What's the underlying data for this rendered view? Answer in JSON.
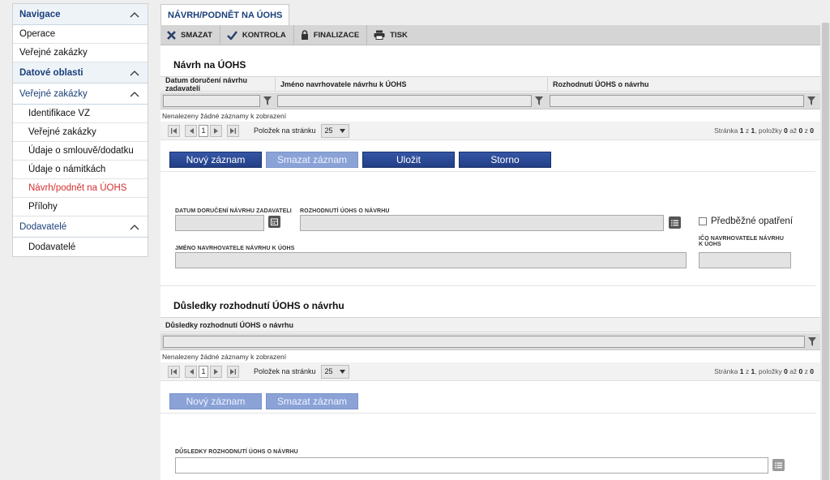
{
  "sidebar": {
    "nav_title": "Navigace",
    "nav_items": [
      "Operace",
      "Veřejné zakázky"
    ],
    "data_title": "Datové oblasti",
    "vz_title": "Veřejné zakázky",
    "vz_items": [
      "Identifikace VZ",
      "Veřejné zakázky",
      "Údaje o smlouvě/dodatku",
      "Údaje o námitkách",
      "Návrh/podnět na ÚOHS",
      "Přílohy"
    ],
    "dod_title": "Dodavatelé",
    "dod_items": [
      "Dodavatelé"
    ]
  },
  "tab": {
    "label": "NÁVRH/PODNĚT NA ÚOHS"
  },
  "toolbar": {
    "delete": "SMAZAT",
    "check": "KONTROLA",
    "finalize": "FINALIZACE",
    "print": "TISK"
  },
  "section1": {
    "title": "Návrh na ÚOHS",
    "columns": [
      "Datum doručení návrhu zadavateli",
      "Jméno navrhovatele návrhu k ÚOHS",
      "Rozhodnutí ÚOHS o návrhu"
    ],
    "no_records": "Nenalezeny žádné záznamy k zobrazení",
    "pager": {
      "page": "1",
      "per_page_label": "Položek na stránku",
      "per_page": "25",
      "info_prefix": "Stránka ",
      "page_current": "1",
      "info_of": " z ",
      "page_total": "1",
      "info_items": ", položky ",
      "from": "0",
      "info_to": " až ",
      "to": "0",
      "info_z": " z ",
      "total": "0"
    },
    "buttons": {
      "new": "Nový záznam",
      "delete": "Smazat záznam",
      "save": "Uložit",
      "cancel": "Storno"
    },
    "form": {
      "date_label": "DATUM DORUČENÍ NÁVRHU ZADAVATELI",
      "decision_label": "ROZHODNUTÍ ÚOHS O NÁVRHU",
      "prelim_label": "Předběžné opatření",
      "name_label": "JMÉNO NAVRHOVATELE NÁVRHU K ÚOHS",
      "ico_label_1": "IČO NAVRHOVATELE NÁVRHU",
      "ico_label_2": "K ÚOHS"
    }
  },
  "section2": {
    "title": "Důsledky rozhodnutí ÚOHS o návrhu",
    "columns": [
      "Důsledky rozhodnutí ÚOHS o návrhu"
    ],
    "no_records": "Nenalezeny žádné záznamy k zobrazení",
    "pager": {
      "page": "1",
      "per_page_label": "Položek na stránku",
      "per_page": "25",
      "info_prefix": "Stránka ",
      "page_current": "1",
      "info_of": " z ",
      "page_total": "1",
      "info_items": ", položky ",
      "from": "0",
      "info_to": " až ",
      "to": "0",
      "info_z": " z ",
      "total": "0"
    },
    "buttons": {
      "new": "Nový záznam",
      "delete": "Smazat záznam"
    },
    "form": {
      "consequence_label": "DŮSLEDKY ROZHODNUTÍ ÚOHS O NÁVRHU"
    }
  }
}
